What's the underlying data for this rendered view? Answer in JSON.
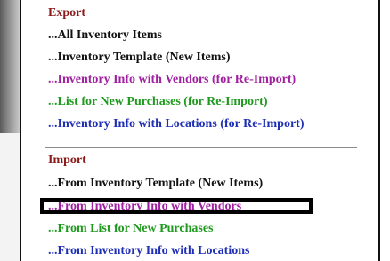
{
  "menu": {
    "export": {
      "heading": "Export",
      "items": [
        {
          "label": "...All Inventory Items",
          "color": "#111111"
        },
        {
          "label": "...Inventory Template (New Items)",
          "color": "#111111"
        },
        {
          "label": "...Inventory Info with Vendors (for Re-Import)",
          "color": "#a11fa1"
        },
        {
          "label": "...List for New Purchases (for Re-Import)",
          "color": "#1f9a1f"
        },
        {
          "label": "...Inventory Info with Locations (for Re-Import)",
          "color": "#1f2fb5"
        }
      ]
    },
    "import": {
      "heading": "Import",
      "items": [
        {
          "label": "...From Inventory Template (New Items)",
          "color": "#111111"
        },
        {
          "label": "...From Inventory Info with Vendors",
          "color": "#a11fa1",
          "highlighted": true
        },
        {
          "label": "...From List for New Purchases",
          "color": "#1f9a1f"
        },
        {
          "label": "...From Inventory Info with Locations",
          "color": "#1f2fb5"
        }
      ]
    }
  },
  "colors": {
    "heading": "#8b1a1a",
    "highlight_border": "#000000"
  }
}
